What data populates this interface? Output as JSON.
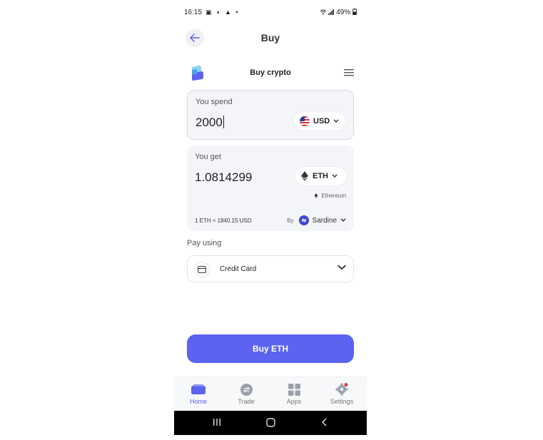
{
  "status_bar": {
    "time": "16:15",
    "left_icons": "▣ ◗ ▲ •",
    "right_text": "49%"
  },
  "header": {
    "title": "Buy"
  },
  "widget": {
    "title": "Buy crypto"
  },
  "spend": {
    "label": "You spend",
    "amount": "2000",
    "currency": "USD"
  },
  "get": {
    "label": "You get",
    "amount": "1.0814299",
    "currency": "ETH",
    "network": "Ethereum",
    "rate": "1 ETH ≈ 1840.15 USD",
    "by_label": "By",
    "provider": "Sardine"
  },
  "payment": {
    "label": "Pay using",
    "method": "Credit Card"
  },
  "buy_button": {
    "label": "Buy ETH"
  },
  "tabs": [
    {
      "label": "Home",
      "icon": "wallet-icon",
      "active": true
    },
    {
      "label": "Trade",
      "icon": "swap-icon",
      "active": false
    },
    {
      "label": "Apps",
      "icon": "apps-icon",
      "active": false
    },
    {
      "label": "Settings",
      "icon": "gear-icon",
      "active": false
    }
  ],
  "colors": {
    "accent": "#5b63f0",
    "card_bg": "#f4f5f8",
    "notification": "#e53935"
  }
}
